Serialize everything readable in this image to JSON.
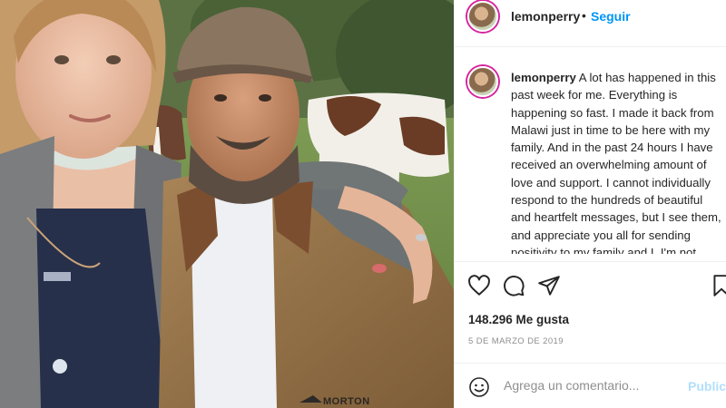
{
  "post": {
    "username": "lemonperry",
    "follow_separator": "•",
    "follow_label": "Seguir",
    "caption_text": "A lot has happened in this past week for me. Everything is happening so fast. I made it back from Malawi just in time to be here with my family. And in the past 24 hours I have received an overwhelming amount of love and support. I cannot individually respond to the hundreds of beautiful and heartfelt messages, but I see them, and appreciate you all for sending positivity to my family and I. I'm not",
    "likes": "148.296 Me gusta",
    "date": "5 DE MARZO DE 2019"
  },
  "actions": {
    "like_icon": "heart-icon",
    "comment_icon": "comment-icon",
    "share_icon": "paper-plane-icon",
    "save_icon": "bookmark-icon"
  },
  "comment_box": {
    "placeholder": "Agrega un comentario...",
    "publish_label": "Publicar",
    "emoji_icon": "smiley-icon"
  },
  "photo": {
    "jacket_text": "MORTON",
    "description_icon": "photo-image"
  },
  "colors": {
    "link_blue": "#0095f6",
    "publish_disabled": "#b2dffc",
    "story_ring": "#d6249f"
  }
}
